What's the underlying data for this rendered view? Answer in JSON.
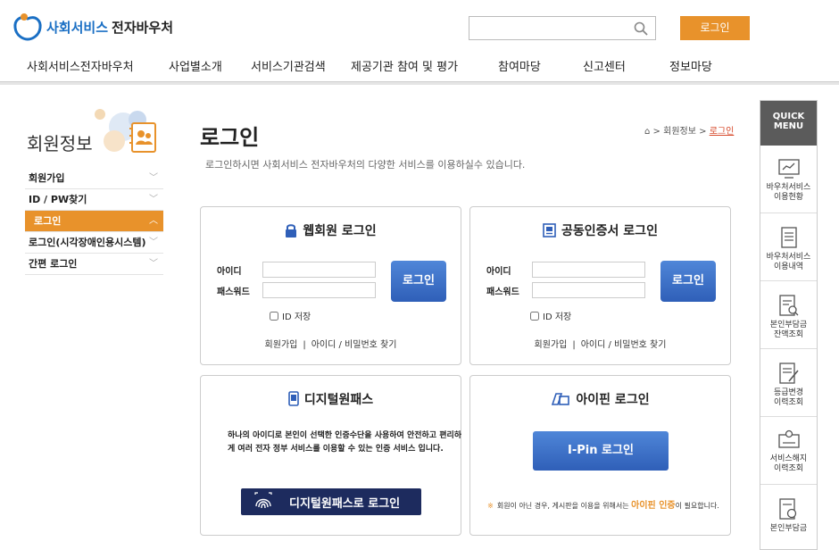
{
  "header": {
    "logo_main": "사회서비스",
    "logo_sub": "전자바우처",
    "search_placeholder": "",
    "login_label": "로그인"
  },
  "gnb": [
    "사회서비스전자바우처",
    "사업별소개",
    "서비스기관검색",
    "제공기관 참여 및 평가",
    "참여마당",
    "신고센터",
    "정보마당"
  ],
  "sidebar": {
    "title": "회원정보",
    "items": [
      {
        "label": "회원가입",
        "active": false
      },
      {
        "label": "ID / PW찾기",
        "active": false
      },
      {
        "label": "로그인",
        "active": true
      },
      {
        "label": "로그인(시각장애인용시스템)",
        "active": false
      },
      {
        "label": "간편 로그인",
        "active": false
      }
    ]
  },
  "main": {
    "title": "로그인",
    "description": "로그인하시면 사회서비스 전자바우처의 다양한 서비스를 이용하실수 있습니다.",
    "breadcrumb": {
      "home_icon": "home-icon",
      "sep1": ">",
      "level1": "회원정보",
      "sep2": ">",
      "current": "로그인"
    }
  },
  "web_login": {
    "title": "웹회원 로그인",
    "id_label": "아이디",
    "pw_label": "패스워드",
    "button": "로그인",
    "save_id": "ID 저장",
    "join_link": "회원가입",
    "sep": "|",
    "find_link": "아이디 / 비밀번호 찾기"
  },
  "cert_login": {
    "title": "공동인증서 로그인",
    "id_label": "아이디",
    "pw_label": "패스워드",
    "button": "로그인",
    "save_id": "ID 저장",
    "join_link": "회원가입",
    "sep": "|",
    "find_link": "아이디 / 비밀번호 찾기"
  },
  "digital_pass": {
    "title": "디지털원패스",
    "description": "하나의 아이디로 본인이 선택한 인증수단을 사용하여 안전하고 편리하게 여러 전자 정부 서비스를 이용할 수 있는 인증 서비스 입니다.",
    "button": "디지털원패스로 로그인"
  },
  "ipin": {
    "title": "아이핀 로그인",
    "button": "I-Pin 로그인",
    "notice_star": "※",
    "notice_pre": "회원이 아닌 경우, 게시판을 이용을 위해서는",
    "notice_highlight": "아이핀 인증",
    "notice_post": "이 필요합니다."
  },
  "quick_menu": {
    "title_line1": "QUICK",
    "title_line2": "MENU",
    "items": [
      {
        "line1": "바우처서비스",
        "line2": "이용현황",
        "icon": "chart-icon"
      },
      {
        "line1": "바우처서비스",
        "line2": "이용내역",
        "icon": "document-list-icon"
      },
      {
        "line1": "본인부담금",
        "line2": "잔액조회",
        "icon": "document-search-icon"
      },
      {
        "line1": "등급변경",
        "line2": "이력조회",
        "icon": "document-edit-icon"
      },
      {
        "line1": "서비스해지",
        "line2": "이력조회",
        "icon": "person-card-icon"
      },
      {
        "line1": "본인부담금",
        "line2": "",
        "icon": "document-won-icon"
      }
    ]
  },
  "colors": {
    "accent": "#e8922b",
    "brand_blue": "#1a6fc4",
    "button_blue": "#3a6cc6",
    "navy": "#1d2b5e"
  }
}
